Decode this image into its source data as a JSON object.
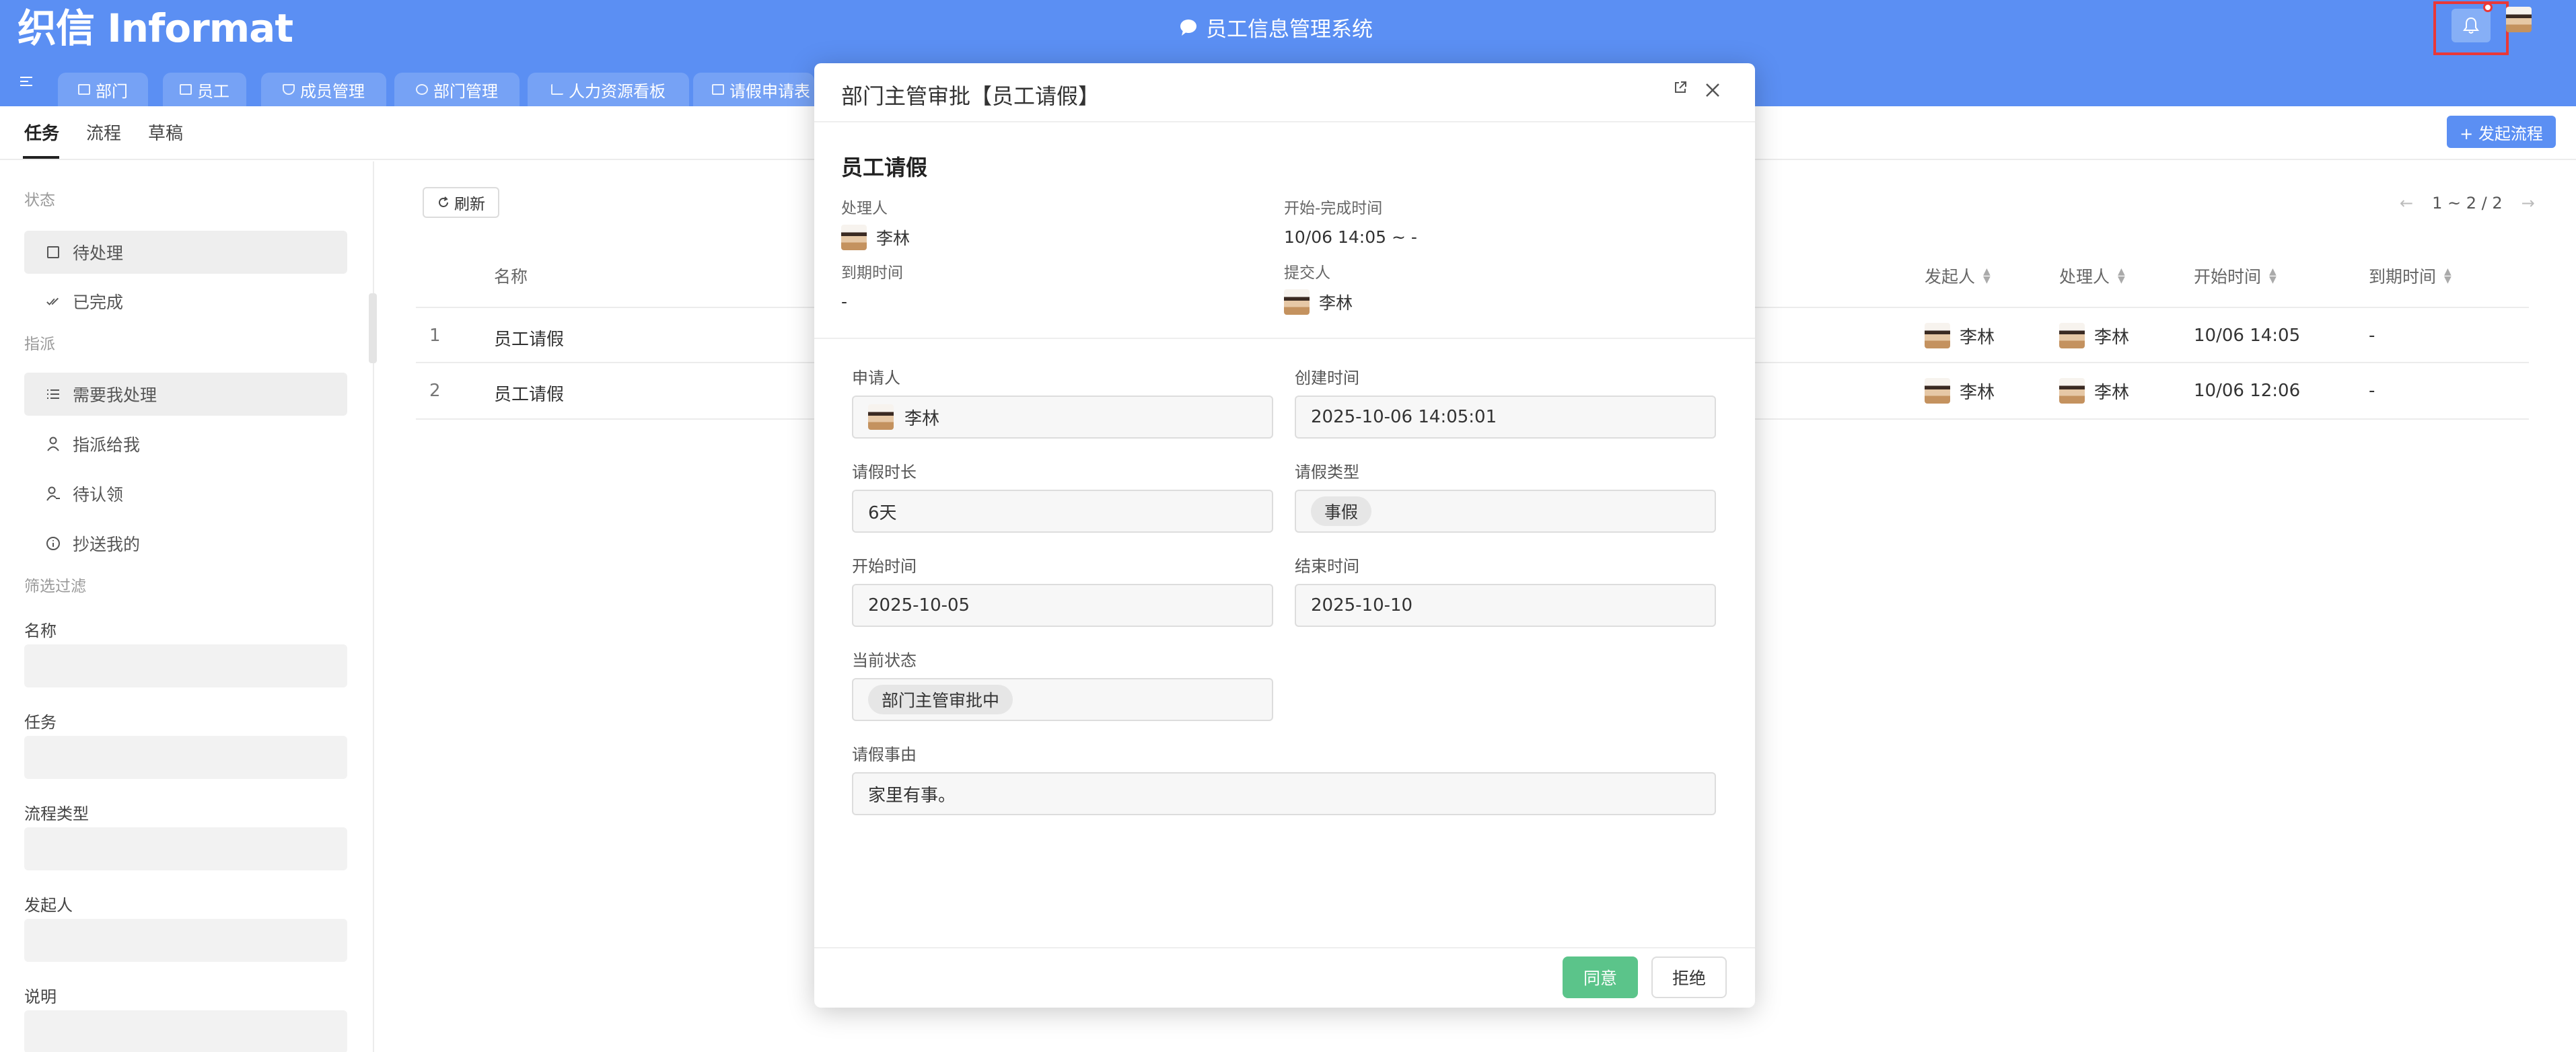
{
  "header": {
    "logo": "织信 Informat",
    "app_title": "员工信息管理系统"
  },
  "tabs": [
    {
      "label": "部门",
      "icon": "table-icon"
    },
    {
      "label": "员工",
      "icon": "table-icon"
    },
    {
      "label": "成员管理",
      "icon": "shield-icon"
    },
    {
      "label": "部门管理",
      "icon": "users-icon"
    },
    {
      "label": "人力资源看板",
      "icon": "chart-icon"
    },
    {
      "label": "请假申请表",
      "icon": "table-icon"
    }
  ],
  "subnav": {
    "tab1": "任务",
    "tab2": "流程",
    "tab3": "草稿",
    "start_button": "+ 发起流程"
  },
  "sidebar": {
    "section_status": "状态",
    "status_items": [
      "待处理",
      "已完成"
    ],
    "section_assign": "指派",
    "assign_items": [
      "需要我处理",
      "指派给我",
      "待认领",
      "抄送我的"
    ],
    "section_filter": "筛选过滤",
    "filter_fields": [
      "名称",
      "任务",
      "流程类型",
      "发起人",
      "说明"
    ]
  },
  "list": {
    "refresh_label": "刷新",
    "pager": "1 ~ 2 / 2",
    "headers": {
      "name": "名称",
      "initiator": "发起人",
      "handler": "处理人",
      "start": "开始时间",
      "due": "到期时间"
    },
    "rows": [
      {
        "num": "1",
        "name": "员工请假",
        "initiator": "李林",
        "handler": "李林",
        "start": "10/06 14:05",
        "due": "-"
      },
      {
        "num": "2",
        "name": "员工请假",
        "initiator": "李林",
        "handler": "李林",
        "start": "10/06 12:06",
        "due": "-"
      }
    ]
  },
  "modal": {
    "title": "部门主管审批【员工请假】",
    "subtitle": "员工请假",
    "handler_label": "处理人",
    "handler_value": "李林",
    "time_label": "开始-完成时间",
    "time_value": "10/06 14:05 ~ -",
    "due_label": "到期时间",
    "due_value": "-",
    "submitter_label": "提交人",
    "submitter_value": "李林",
    "form": {
      "applicant_label": "申请人",
      "applicant_value": "李林",
      "created_label": "创建时间",
      "created_value": "2025-10-06 14:05:01",
      "duration_label": "请假时长",
      "duration_value": "6天",
      "type_label": "请假类型",
      "type_value": "事假",
      "start_label": "开始时间",
      "start_value": "2025-10-05",
      "end_label": "结束时间",
      "end_value": "2025-10-10",
      "status_label": "当前状态",
      "status_value": "部门主管审批中",
      "reason_label": "请假事由",
      "reason_value": "家里有事。"
    },
    "agree_label": "同意",
    "reject_label": "拒绝"
  },
  "colors": {
    "topbar": "#5b8ff3",
    "agree": "#5bc48a",
    "highlight": "#e93838"
  }
}
